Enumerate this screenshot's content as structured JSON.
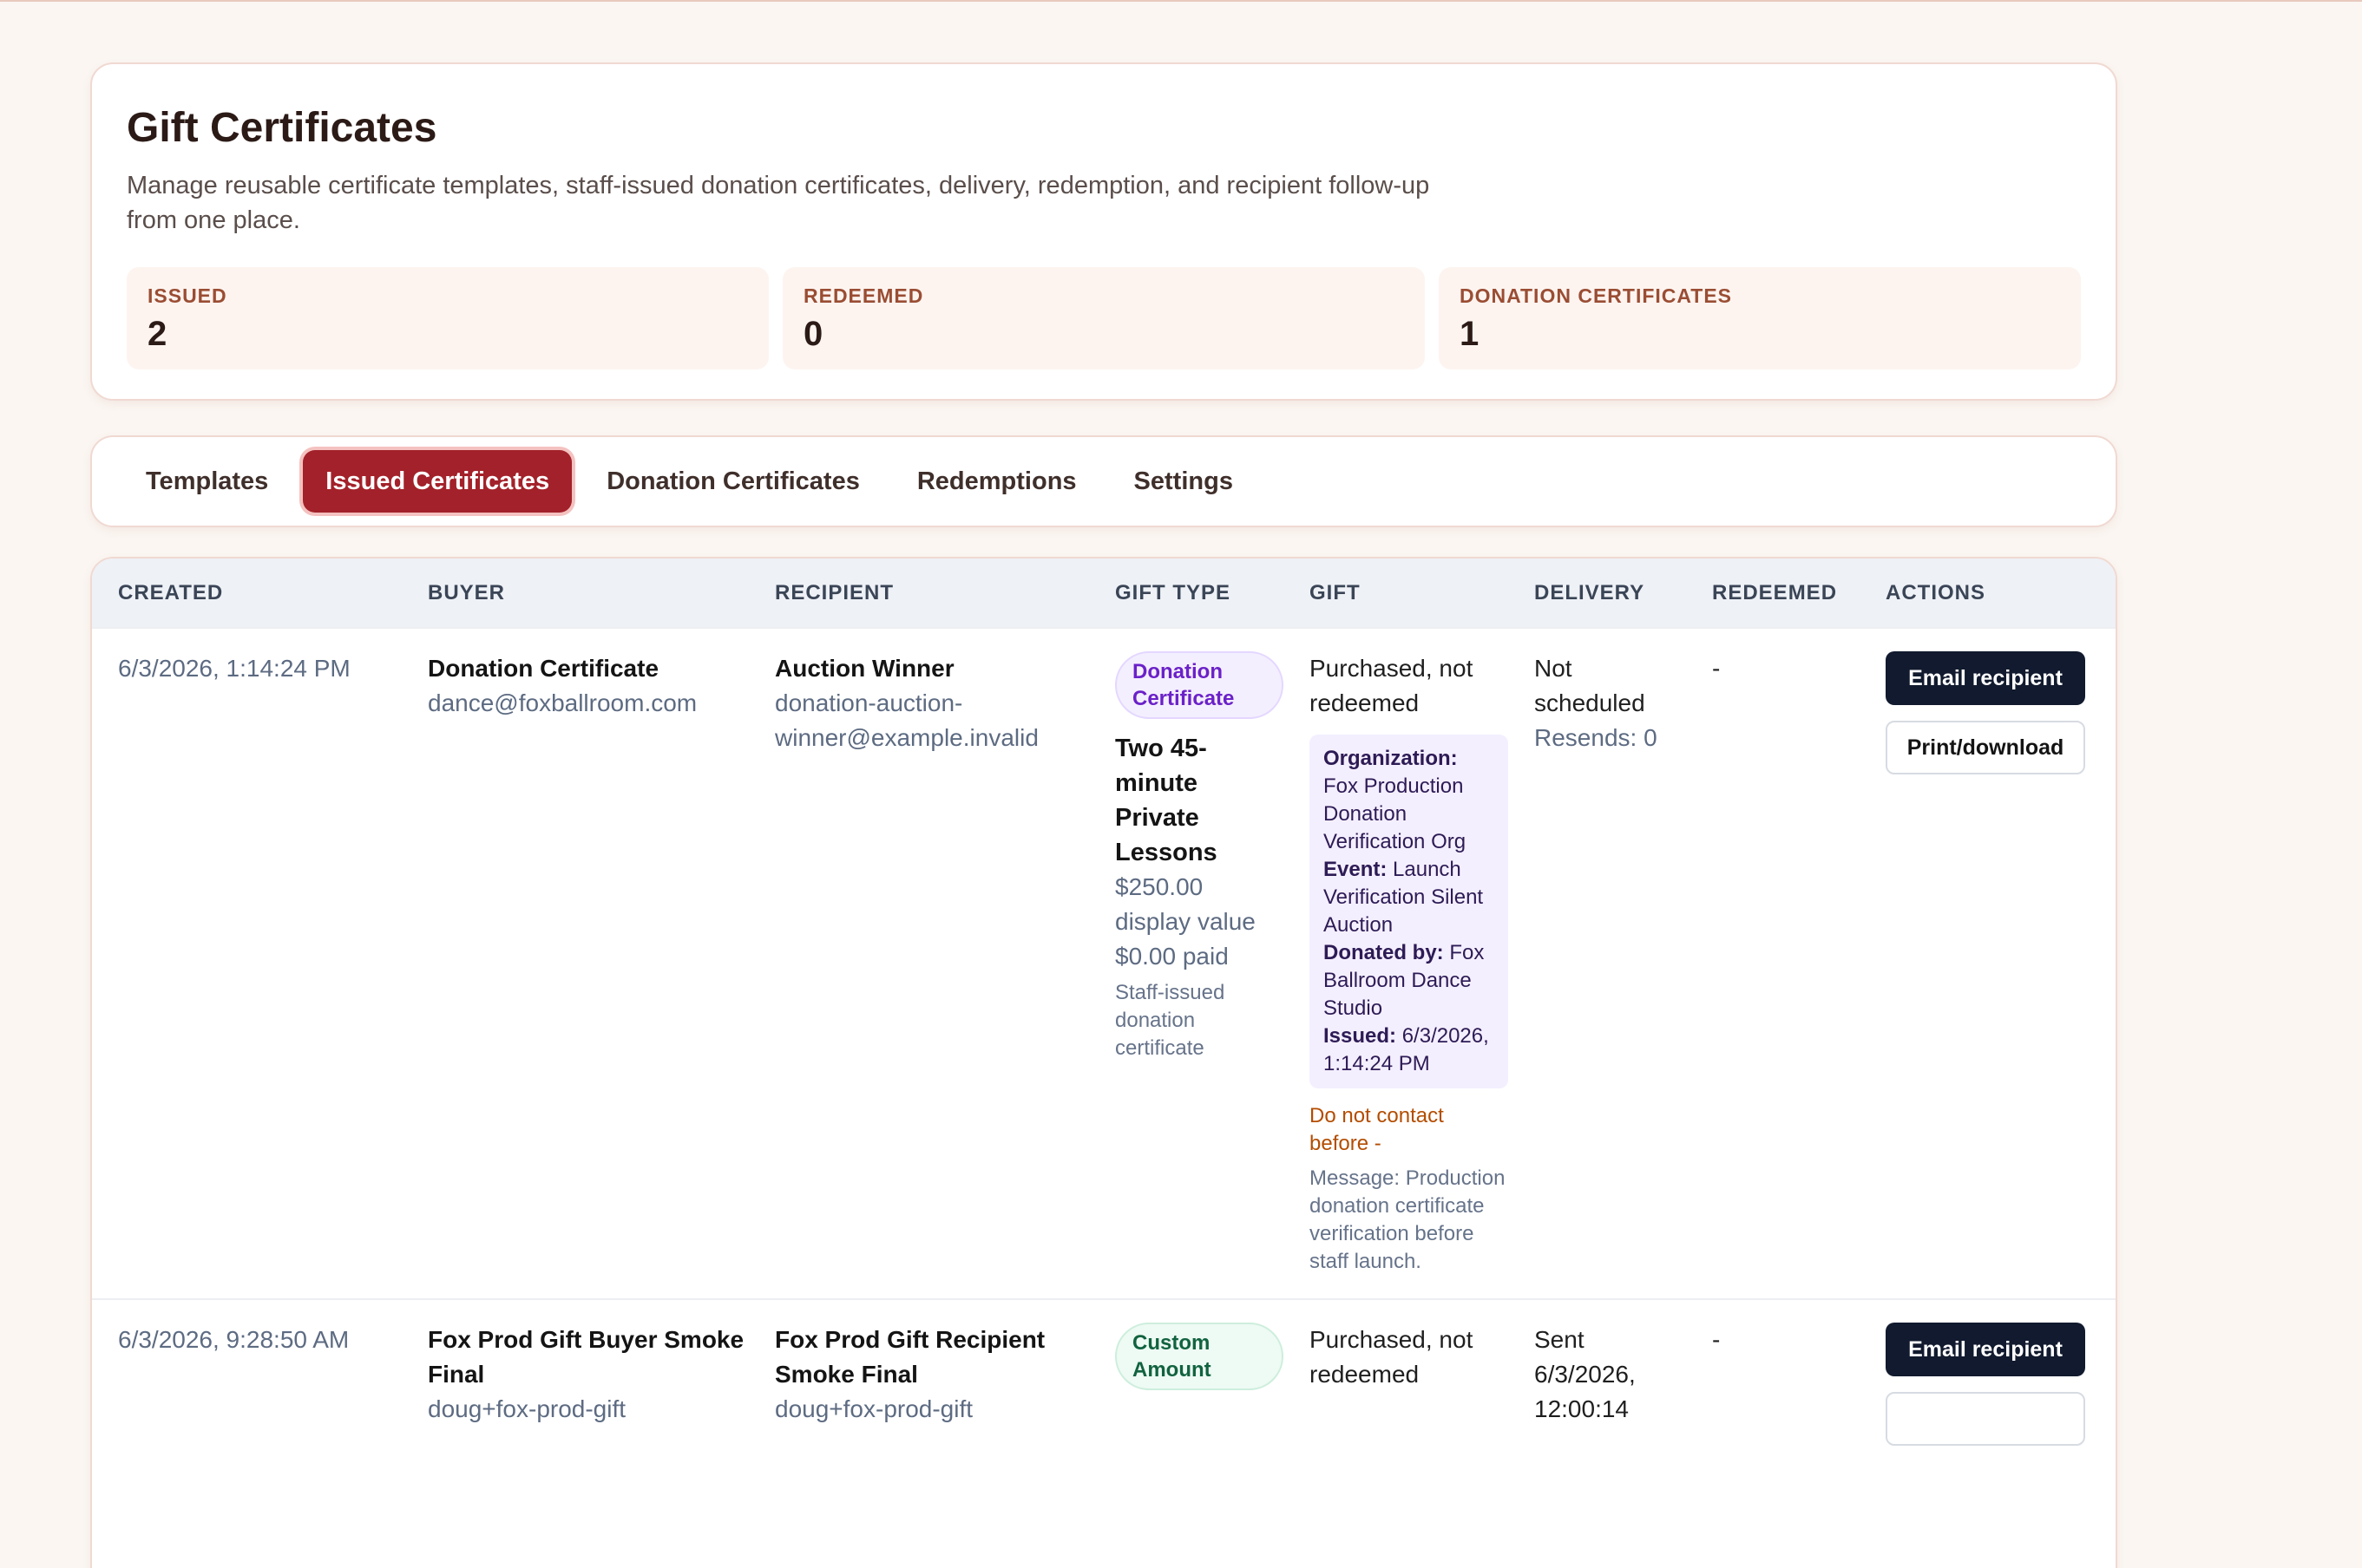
{
  "header": {
    "title": "Gift Certificates",
    "description": "Manage reusable certificate templates, staff-issued donation certificates, delivery, redemption, and recipient follow-up from one place."
  },
  "stats": [
    {
      "label": "ISSUED",
      "value": "2"
    },
    {
      "label": "REDEEMED",
      "value": "0"
    },
    {
      "label": "DONATION CERTIFICATES",
      "value": "1"
    }
  ],
  "tabs": [
    {
      "label": "Templates",
      "active": false
    },
    {
      "label": "Issued Certificates",
      "active": true
    },
    {
      "label": "Donation Certificates",
      "active": false
    },
    {
      "label": "Redemptions",
      "active": false
    },
    {
      "label": "Settings",
      "active": false
    }
  ],
  "table": {
    "columns": [
      "CREATED",
      "BUYER",
      "RECIPIENT",
      "GIFT TYPE",
      "GIFT",
      "DELIVERY",
      "REDEEMED",
      "ACTIONS"
    ],
    "rows": [
      {
        "created": "6/3/2026, 1:14:24 PM",
        "buyer_name": "Donation Certificate",
        "buyer_email": "dance@foxballroom.com",
        "recipient_name": "Auction Winner",
        "recipient_email": "donation-auction-winner@example.invalid",
        "gift_type_badge": "Donation Certificate",
        "gift_type_title": "Two 45-minute Private Lessons",
        "display_value": "$250.00 display value",
        "paid": "$0.00 paid",
        "note": "Staff-issued donation certificate",
        "gift_status": "Purchased, not redeemed",
        "org_label": "Organization:",
        "org_value": "Fox Production Donation Verification Org",
        "event_label": "Event:",
        "event_value": "Launch Verification Silent Auction",
        "donated_label": "Donated by:",
        "donated_value": "Fox Ballroom Dance Studio",
        "issued_label": "Issued:",
        "issued_value": "6/3/2026, 1:14:24 PM",
        "do_not_contact": "Do not contact before -",
        "message": "Message: Production donation certificate verification before staff launch.",
        "delivery": "Not scheduled",
        "resends": "Resends: 0",
        "redeemed": "-",
        "action_primary": "Email recipient",
        "action_secondary": "Print/download"
      },
      {
        "created": "6/3/2026, 9:28:50 AM",
        "buyer_name": "Fox Prod Gift Buyer Smoke Final",
        "buyer_email": "doug+fox-prod-gift",
        "recipient_name": "Fox Prod Gift Recipient Smoke Final",
        "recipient_email": "doug+fox-prod-gift",
        "gift_type_badge": "Custom Amount",
        "gift_status": "Purchased, not redeemed",
        "delivery": "Sent 6/3/2026, 12:00:14",
        "redeemed": "-",
        "action_primary": "Email recipient"
      }
    ]
  }
}
